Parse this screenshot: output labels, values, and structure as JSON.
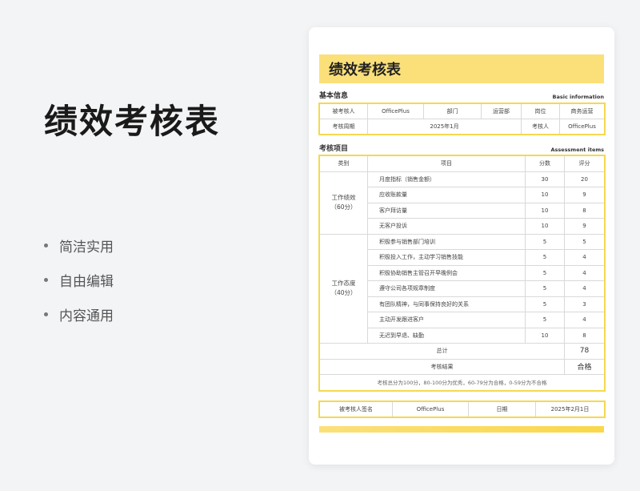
{
  "hero": {
    "title": "绩效考核表",
    "features": [
      "简洁实用",
      "自由编辑",
      "内容通用"
    ]
  },
  "doc": {
    "title": "绩效考核表",
    "basic": {
      "title_cn": "基本信息",
      "title_en": "Basic information",
      "row1": [
        "被考核人",
        "OfficePlus",
        "部门",
        "运营部",
        "岗位",
        "商务运营"
      ],
      "row2": [
        "考核周期",
        "2025年1月",
        "考核人",
        "OfficePlus"
      ]
    },
    "assessment": {
      "title_cn": "考核项目",
      "title_en": "Assessment items",
      "headers": [
        "类别",
        "项目",
        "分数",
        "评分"
      ],
      "groups": [
        {
          "category": "工作绩效",
          "sub": "（60分）",
          "items": [
            {
              "item": "月度指标（销售金额）",
              "score": "30",
              "rating": "20"
            },
            {
              "item": "应收账款量",
              "score": "10",
              "rating": "9"
            },
            {
              "item": "客户拜访量",
              "score": "10",
              "rating": "8"
            },
            {
              "item": "无客户投诉",
              "score": "10",
              "rating": "9"
            }
          ]
        },
        {
          "category": "工作态度",
          "sub": "（40分）",
          "items": [
            {
              "item": "积极参与销售部门培训",
              "score": "5",
              "rating": "5"
            },
            {
              "item": "积极投入工作，主动学习销售技能",
              "score": "5",
              "rating": "4"
            },
            {
              "item": "积极协助销售主管召开早晚例会",
              "score": "5",
              "rating": "4"
            },
            {
              "item": "遵守公司各项规章制度",
              "score": "5",
              "rating": "4"
            },
            {
              "item": "有团队精神，与同事保持良好的关系",
              "score": "5",
              "rating": "3"
            },
            {
              "item": "主动开发跟进客户",
              "score": "5",
              "rating": "4"
            },
            {
              "item": "无迟到早退、缺勤",
              "score": "10",
              "rating": "8"
            }
          ]
        }
      ],
      "total_label": "总计",
      "total_value": "78",
      "result_label": "考核结果",
      "result_value": "合格",
      "note": "考核总分为100分，80-100分为优秀，60-79分为合格，0-59分为不合格"
    },
    "sign": [
      "被考核人签名",
      "OfficePlus",
      "日期",
      "2025年2月1日"
    ]
  }
}
